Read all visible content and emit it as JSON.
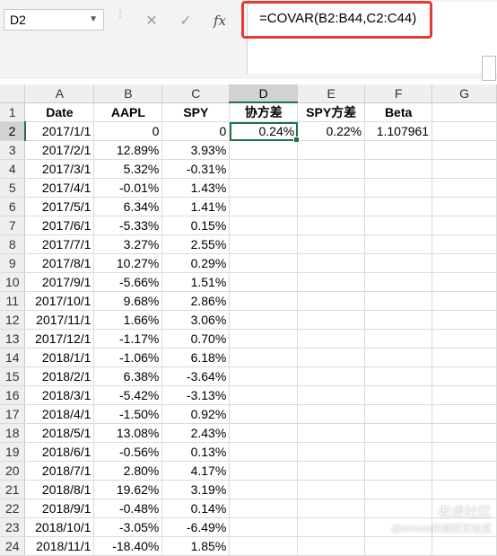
{
  "name_box": {
    "value": "D2"
  },
  "formula_bar": {
    "cancel_icon": "close-icon",
    "enter_icon": "check-icon",
    "fx_label": "fx",
    "formula": "=COVAR(B2:B44,C2:C44)"
  },
  "columns": [
    "A",
    "B",
    "C",
    "D",
    "E",
    "F",
    "G"
  ],
  "active_cell": "D2",
  "rows": [
    {
      "n": "1",
      "cells": [
        "Date",
        "AAPL",
        "SPY",
        "协方差",
        "SPY方差",
        "Beta",
        ""
      ]
    },
    {
      "n": "2",
      "cells": [
        "2017/1/1",
        "0",
        "0",
        "0.24%",
        "0.22%",
        "1.107961",
        ""
      ]
    },
    {
      "n": "3",
      "cells": [
        "2017/2/1",
        "12.89%",
        "3.93%",
        "",
        "",
        "",
        ""
      ]
    },
    {
      "n": "4",
      "cells": [
        "2017/3/1",
        "5.32%",
        "-0.31%",
        "",
        "",
        "",
        ""
      ]
    },
    {
      "n": "5",
      "cells": [
        "2017/4/1",
        "-0.01%",
        "1.43%",
        "",
        "",
        "",
        ""
      ]
    },
    {
      "n": "6",
      "cells": [
        "2017/5/1",
        "6.34%",
        "1.41%",
        "",
        "",
        "",
        ""
      ]
    },
    {
      "n": "7",
      "cells": [
        "2017/6/1",
        "-5.33%",
        "0.15%",
        "",
        "",
        "",
        ""
      ]
    },
    {
      "n": "8",
      "cells": [
        "2017/7/1",
        "3.27%",
        "2.55%",
        "",
        "",
        "",
        ""
      ]
    },
    {
      "n": "9",
      "cells": [
        "2017/8/1",
        "10.27%",
        "0.29%",
        "",
        "",
        "",
        ""
      ]
    },
    {
      "n": "10",
      "cells": [
        "2017/9/1",
        "-5.66%",
        "1.51%",
        "",
        "",
        "",
        ""
      ]
    },
    {
      "n": "11",
      "cells": [
        "2017/10/1",
        "9.68%",
        "2.86%",
        "",
        "",
        "",
        ""
      ]
    },
    {
      "n": "12",
      "cells": [
        "2017/11/1",
        "1.66%",
        "3.06%",
        "",
        "",
        "",
        ""
      ]
    },
    {
      "n": "13",
      "cells": [
        "2017/12/1",
        "-1.17%",
        "0.70%",
        "",
        "",
        "",
        ""
      ]
    },
    {
      "n": "14",
      "cells": [
        "2018/1/1",
        "-1.06%",
        "6.18%",
        "",
        "",
        "",
        ""
      ]
    },
    {
      "n": "15",
      "cells": [
        "2018/2/1",
        "6.38%",
        "-3.64%",
        "",
        "",
        "",
        ""
      ]
    },
    {
      "n": "16",
      "cells": [
        "2018/3/1",
        "-5.42%",
        "-3.13%",
        "",
        "",
        "",
        ""
      ]
    },
    {
      "n": "17",
      "cells": [
        "2018/4/1",
        "-1.50%",
        "0.92%",
        "",
        "",
        "",
        ""
      ]
    },
    {
      "n": "18",
      "cells": [
        "2018/5/1",
        "13.08%",
        "2.43%",
        "",
        "",
        "",
        ""
      ]
    },
    {
      "n": "19",
      "cells": [
        "2018/6/1",
        "-0.56%",
        "0.13%",
        "",
        "",
        "",
        ""
      ]
    },
    {
      "n": "20",
      "cells": [
        "2018/7/1",
        "2.80%",
        "4.17%",
        "",
        "",
        "",
        ""
      ]
    },
    {
      "n": "21",
      "cells": [
        "2018/8/1",
        "19.62%",
        "3.19%",
        "",
        "",
        "",
        ""
      ]
    },
    {
      "n": "22",
      "cells": [
        "2018/9/1",
        "-0.48%",
        "0.14%",
        "",
        "",
        "",
        ""
      ]
    },
    {
      "n": "23",
      "cells": [
        "2018/10/1",
        "-3.05%",
        "-6.49%",
        "",
        "",
        "",
        ""
      ]
    },
    {
      "n": "24",
      "cells": [
        "2018/11/1",
        "-18.40%",
        "1.85%",
        "",
        "",
        "",
        ""
      ]
    }
  ],
  "watermark": {
    "line1": "老虎社区",
    "line2": "@simons的期权实验室"
  },
  "colors": {
    "accent": "#217346",
    "highlight": "#e53935"
  }
}
